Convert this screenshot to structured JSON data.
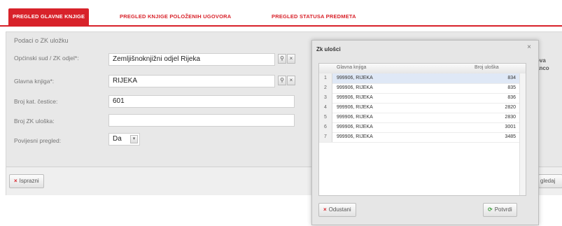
{
  "tabs": [
    {
      "label": "PREGLED GLAVNE KNJIGE",
      "active": true
    },
    {
      "label": "PREGLED KNJIGE POLOŽENIH UGOVORA",
      "active": false
    },
    {
      "label": "PREGLED STATUSA PREDMETA",
      "active": false
    }
  ],
  "form": {
    "section_title": "Podaci o ZK uložku",
    "fields": [
      {
        "label": "Općinski sud / ZK odjel*:",
        "value": "Zemljišnoknjižni odjel Rijeka"
      },
      {
        "label": "Glavna knjiga*:",
        "value": "RIJEKA"
      },
      {
        "label": "Broj kat. čestice:",
        "value": "601"
      },
      {
        "label": "Broj ZK uloška:",
        "value": ""
      },
      {
        "label": "Povijesni pregled:",
        "value": "Da"
      }
    ],
    "search_icon": "search-icon",
    "clear_icon": "clear-icon",
    "select_arrow": "▾"
  },
  "footer": {
    "clear_label": "Isprazni",
    "right_partial_label": "gledaj"
  },
  "background_fragments": [
    "ova",
    "anco"
  ],
  "dialog": {
    "title": "Zk ulošci",
    "close_glyph": "×",
    "columns": [
      "Glavna knjiga",
      "Broj uloška"
    ],
    "rows": [
      {
        "n": "1",
        "knjiga": "999906, RIJEKA",
        "broj": "834",
        "selected": true
      },
      {
        "n": "2",
        "knjiga": "999906, RIJEKA",
        "broj": "835",
        "selected": false
      },
      {
        "n": "3",
        "knjiga": "999906, RIJEKA",
        "broj": "836",
        "selected": false
      },
      {
        "n": "4",
        "knjiga": "999906, RIJEKA",
        "broj": "2820",
        "selected": false
      },
      {
        "n": "5",
        "knjiga": "999906, RIJEKA",
        "broj": "2830",
        "selected": false
      },
      {
        "n": "6",
        "knjiga": "999906, RIJEKA",
        "broj": "3001",
        "selected": false
      },
      {
        "n": "7",
        "knjiga": "999906, RIJEKA",
        "broj": "3485",
        "selected": false
      }
    ],
    "cancel_label": "Odustani",
    "confirm_label": "Potvrdi"
  },
  "colors": {
    "accent": "#d8222a",
    "selection": "#dfe8f6",
    "confirm_icon": "#3a9a3a"
  }
}
